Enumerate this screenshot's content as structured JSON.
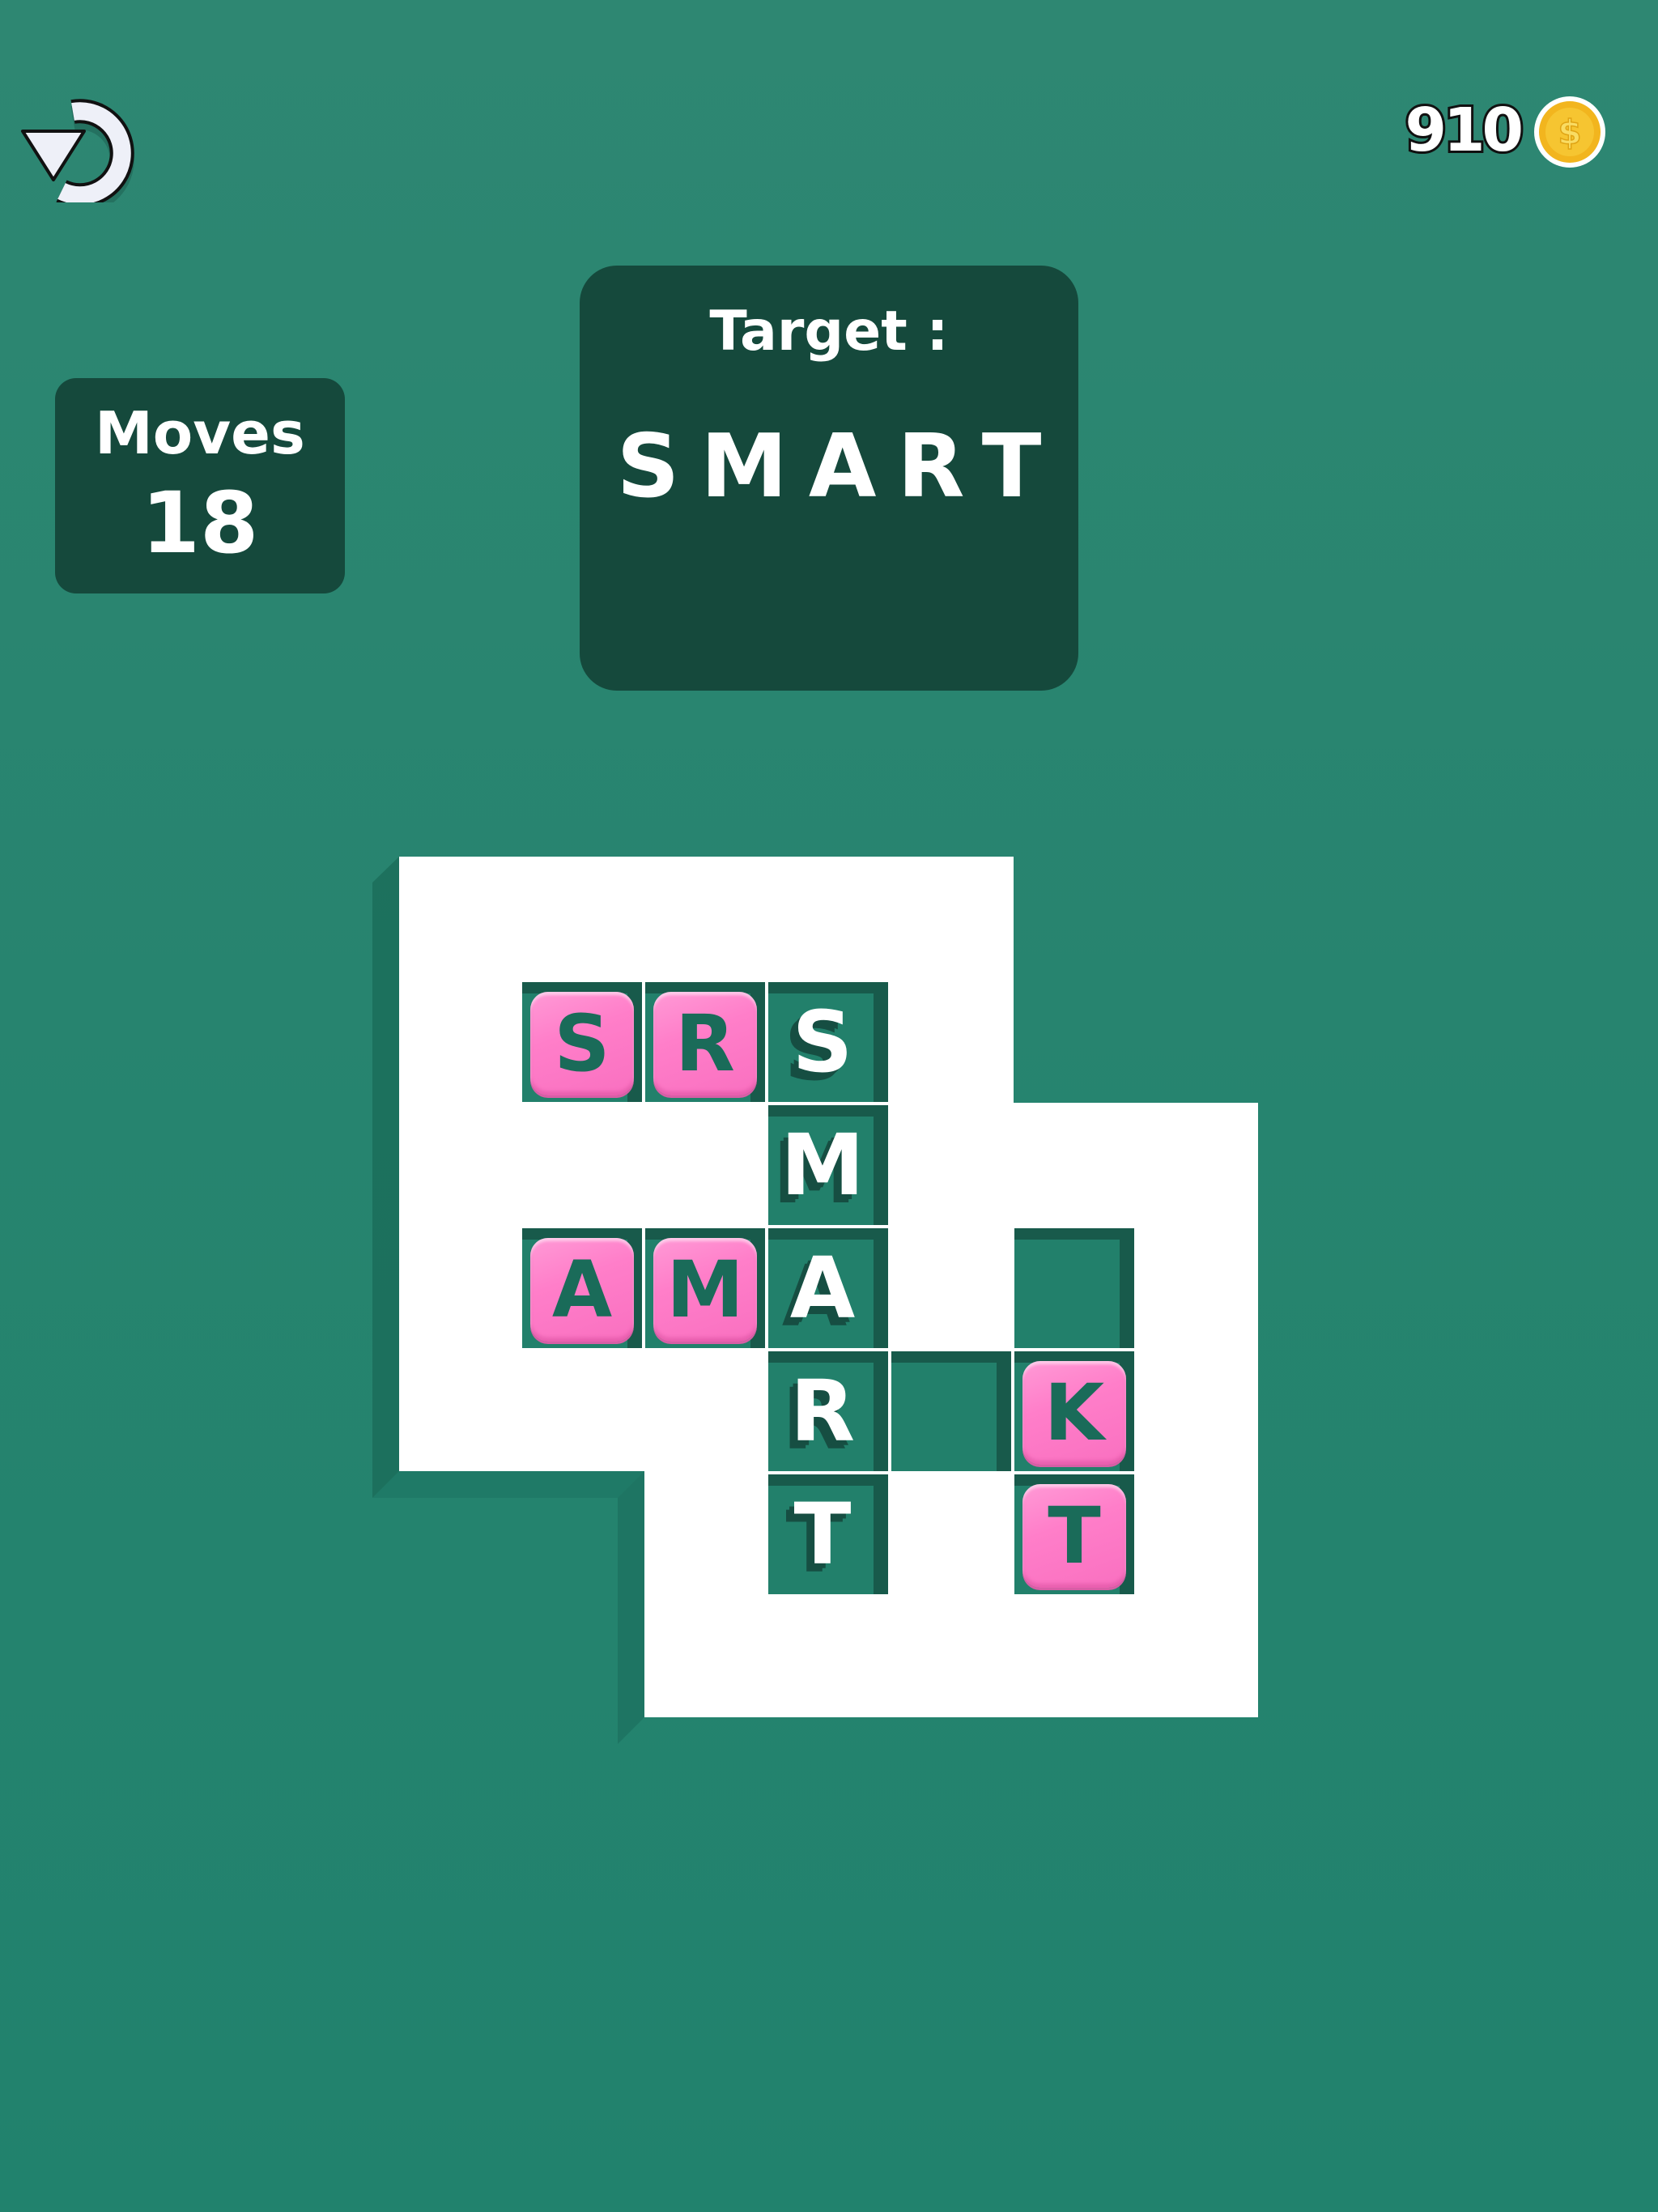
{
  "header": {
    "undo_icon": "undo-icon",
    "coins": "910",
    "coin_icon": "dollar-coin-icon"
  },
  "moves": {
    "label": "Moves",
    "value": "18"
  },
  "target": {
    "label": "Target :",
    "word": "SMART"
  },
  "board": {
    "word_cells": [
      {
        "row": 0,
        "col": 2,
        "letter": "S"
      },
      {
        "row": 1,
        "col": 2,
        "letter": "M"
      },
      {
        "row": 2,
        "col": 2,
        "letter": "A"
      },
      {
        "row": 3,
        "col": 2,
        "letter": "R"
      },
      {
        "row": 4,
        "col": 2,
        "letter": "T"
      }
    ],
    "tiles": [
      {
        "row": 0,
        "col": 0,
        "letter": "S"
      },
      {
        "row": 0,
        "col": 1,
        "letter": "R"
      },
      {
        "row": 2,
        "col": 0,
        "letter": "A"
      },
      {
        "row": 2,
        "col": 1,
        "letter": "M"
      },
      {
        "row": 3,
        "col": 4,
        "letter": "K"
      },
      {
        "row": 4,
        "col": 4,
        "letter": "T"
      }
    ],
    "empty_cells": [
      {
        "row": 2,
        "col": 4
      },
      {
        "row": 3,
        "col": 3
      }
    ]
  },
  "colors": {
    "background": "#21826d",
    "panel": "#15493c",
    "board": "#ffffff",
    "tile": "#ff7ec9",
    "cell": "#22806b",
    "coin": "#f6c531"
  }
}
